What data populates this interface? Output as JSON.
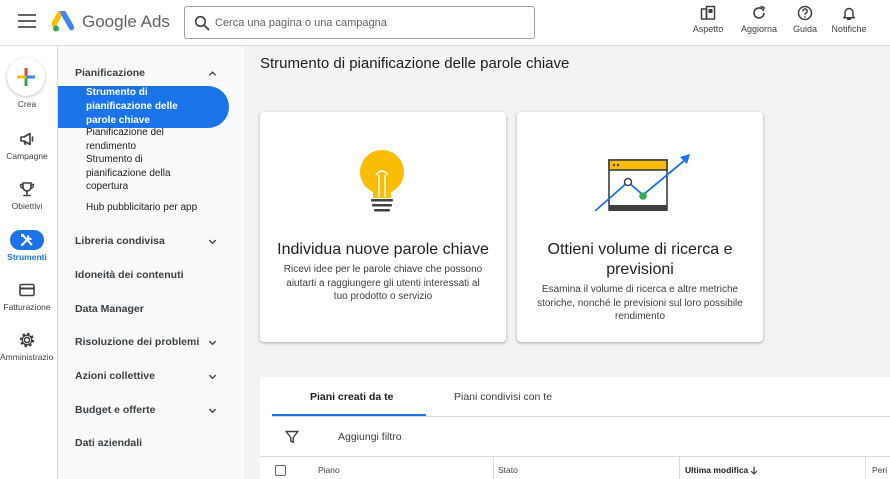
{
  "header": {
    "brand": "Google Ads",
    "search_placeholder": "Cerca una pagina o una campagna",
    "actions": [
      {
        "label": "Aspetto",
        "icon": "appearance-icon"
      },
      {
        "label": "Aggiorna",
        "icon": "refresh-icon"
      },
      {
        "label": "Guida",
        "icon": "help-icon"
      },
      {
        "label": "Notifiche",
        "icon": "bell-icon"
      }
    ]
  },
  "rail": {
    "create_label": "Crea",
    "items": [
      {
        "label": "Campagne",
        "icon": "megaphone-icon"
      },
      {
        "label": "Obiettivi",
        "icon": "trophy-icon"
      },
      {
        "label": "Strumenti",
        "icon": "tools-icon",
        "active": true
      },
      {
        "label": "Fatturazione",
        "icon": "credit-card-icon"
      },
      {
        "label": "Amministrazione",
        "icon": "gear-icon"
      }
    ]
  },
  "sidenav": {
    "section_planning": "Pianificazione",
    "active_item": "Strumento di pianificazione delle parole chiave",
    "sub_items": [
      "Pianificazione del rendimento",
      "Strumento di pianificazione della copertura",
      "Hub pubblicitario per app"
    ],
    "sections": [
      "Libreria condivisa",
      "Idoneità dei contenuti",
      "Data Manager",
      "Risoluzione dei problemi",
      "Azioni collettive",
      "Budget e offerte",
      "Dati aziendali"
    ]
  },
  "main": {
    "title": "Strumento di pianificazione delle parole chiave",
    "cards": [
      {
        "title": "Individua nuove parole chiave",
        "description": "Ricevi idee per le parole chiave che possono aiutarti a raggiungere gli utenti interessati al tuo prodotto o servizio",
        "icon": "lightbulb-icon"
      },
      {
        "title": "Ottieni volume di ricerca e previsioni",
        "description": "Esamina il volume di ricerca e altre metriche storiche, nonché le previsioni sul loro possibile rendimento",
        "icon": "trend-chart-icon"
      }
    ],
    "tabs": [
      "Piani creati da te",
      "Piani condivisi con te"
    ],
    "filter_label": "Aggiungi filtro",
    "columns": [
      "Piano",
      "Stato",
      "Ultima modifica",
      "Peri"
    ]
  },
  "colors": {
    "accent": "#1a73e8",
    "bulb": "#fbbc04"
  }
}
